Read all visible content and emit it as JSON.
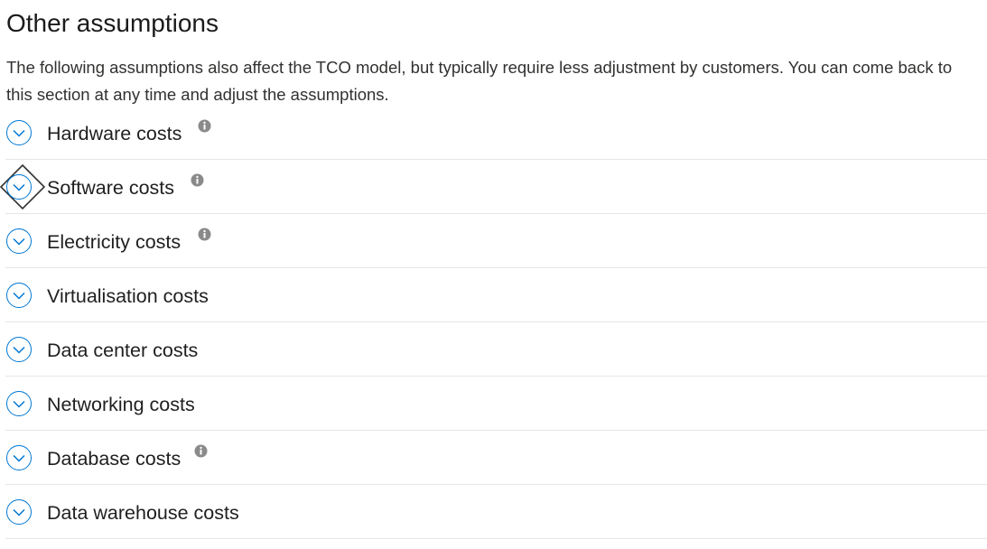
{
  "section": {
    "title": "Other assumptions",
    "description": "The following assumptions also affect the TCO model, but typically require less adjustment by customers. You can come back to this section at any time and adjust the assumptions."
  },
  "accordion": {
    "items": [
      {
        "label": "Hardware costs",
        "has_info": true,
        "expanded": false
      },
      {
        "label": "Software costs",
        "has_info": true,
        "expanded": false,
        "focused": true
      },
      {
        "label": "Electricity costs",
        "has_info": true,
        "expanded": false
      },
      {
        "label": "Virtualisation costs",
        "has_info": false,
        "expanded": false
      },
      {
        "label": "Data center costs",
        "has_info": false,
        "expanded": false
      },
      {
        "label": "Networking costs",
        "has_info": false,
        "expanded": false
      },
      {
        "label": "Database costs",
        "has_info": true,
        "expanded": false
      },
      {
        "label": "Data warehouse costs",
        "has_info": false,
        "expanded": false
      }
    ]
  },
  "icons": {
    "expand": "chevron-down-icon",
    "info": "info-icon"
  },
  "colors": {
    "accent": "#0078d4",
    "info_icon": "#8a8a8a",
    "divider": "#e6e6e6"
  }
}
